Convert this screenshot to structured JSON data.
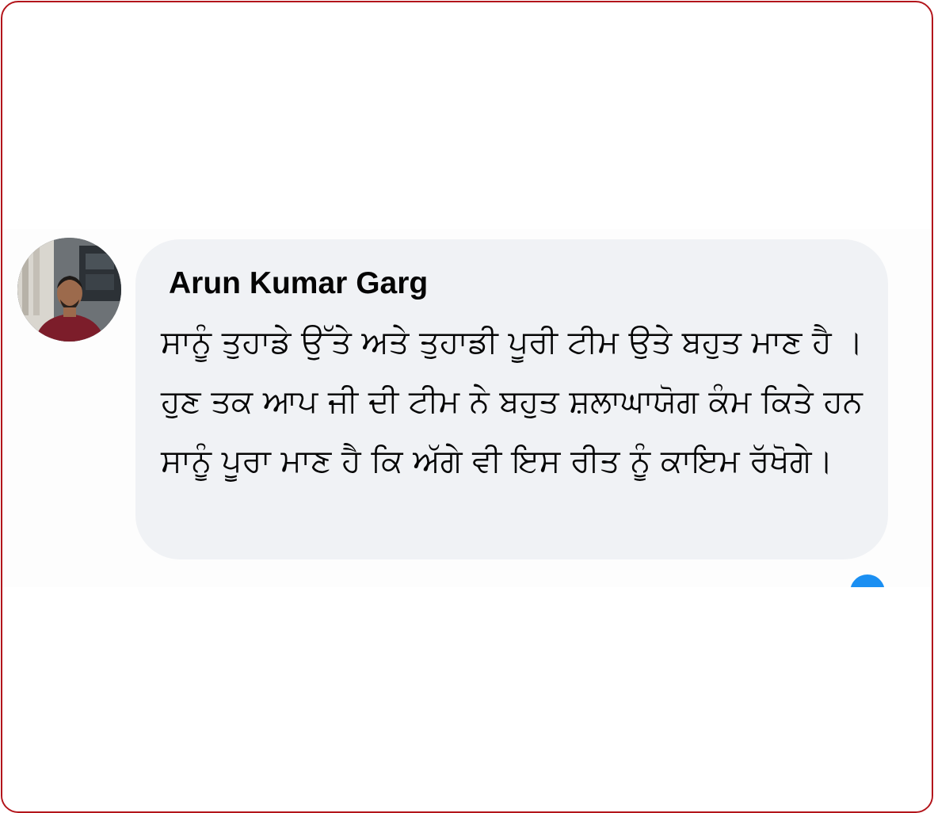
{
  "comment": {
    "author": "Arun Kumar Garg",
    "text": "ਸਾਨੂੰ ਤੁਹਾਡੇ ਉੱਤੇ ਅਤੇ ਤੁਹਾਡੀ ਪੂਰੀ ਟੀਮ ਉਤੇ ਬਹੁਤ ਮਾਣ ਹੈ । ਹੁਣ ਤਕ  ਆਪ ਜੀ ਦੀ ਟੀਮ ਨੇ ਬਹੁਤ ਸ਼ਲਾਘਾਯੋਗ ਕੰਮ ਕਿਤੇ ਹਨ ਸਾਨੂੰ ਪੂਰਾ ਮਾਣ ਹੈ ਕਿ ਅੱਗੇ ਵੀ ਇਸ ਰੀਤ ਨੂੰ ਕਾਇਮ ਰੱਖੋਗੇ।",
    "avatar_icon": "profile-photo",
    "reaction_icon": "like-reaction-icon"
  },
  "colors": {
    "border": "#b3151b",
    "bubble": "#f0f2f5",
    "text": "#050505",
    "reaction": "#1b8ff2"
  }
}
